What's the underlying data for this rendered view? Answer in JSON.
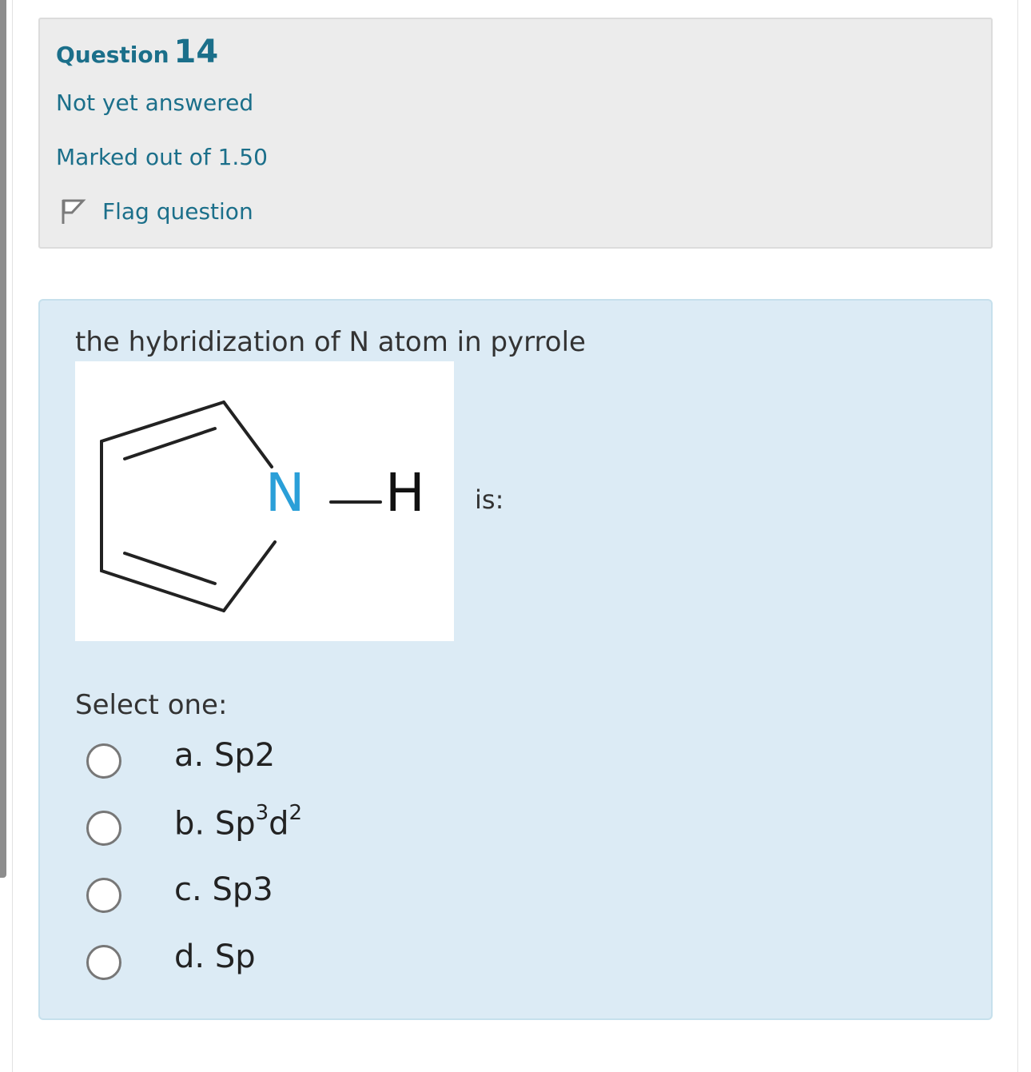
{
  "question": {
    "label": "Question",
    "number": "14",
    "state": "Not yet answered",
    "grade": "Marked out of 1.50",
    "flag_label": "Flag question"
  },
  "content": {
    "text_before_image": "the hybridization of N atom in pyrrole",
    "image": {
      "atom_n": "N",
      "atom_h": "H",
      "n_color": "#2a9fd8"
    },
    "text_after_image": "is:",
    "select_prompt": "Select one:",
    "options": [
      {
        "letter": "a.",
        "text": "Sp2"
      },
      {
        "letter": "b.",
        "base": "Sp",
        "sup1": "3",
        "base2": "d",
        "sup2": "2"
      },
      {
        "letter": "c.",
        "text": "Sp3"
      },
      {
        "letter": "d.",
        "text": "Sp"
      }
    ]
  },
  "colors": {
    "accent": "#1b6f8a",
    "info_bg": "#ececec",
    "content_bg": "#dcebf5"
  }
}
